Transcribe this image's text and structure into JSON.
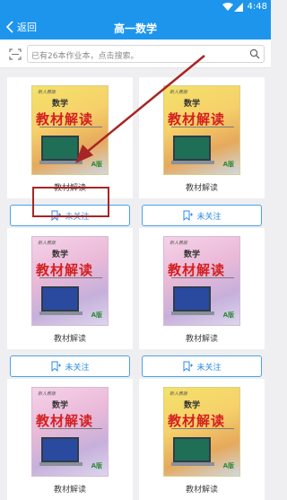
{
  "status": {
    "time": "4:48"
  },
  "nav": {
    "back_label": "返回",
    "title": "高一数学"
  },
  "search": {
    "placeholder": "已有26本作业本，点击搜索。"
  },
  "books": [
    {
      "name": "教材解读",
      "follow": "未关注",
      "cover_subject": "数学",
      "cover_title": "教材解读",
      "cover_publisher": "新人教版",
      "badge": "A版"
    },
    {
      "name": "教材解读",
      "follow": "未关注",
      "cover_subject": "数学",
      "cover_title": "教材解读",
      "cover_publisher": "新人教版",
      "badge": "A版"
    },
    {
      "name": "教材解读",
      "follow": "未关注",
      "cover_subject": "数学",
      "cover_title": "教材解读",
      "cover_publisher": "新人教版",
      "badge": "A版"
    },
    {
      "name": "教材解读",
      "follow": "未关注",
      "cover_subject": "数学",
      "cover_title": "教材解读",
      "cover_publisher": "新人教版",
      "badge": "A版"
    },
    {
      "name": "教材解读",
      "follow": "",
      "cover_subject": "数学",
      "cover_title": "教材解读",
      "cover_publisher": "新人教版",
      "badge": "A版"
    },
    {
      "name": "教材解读",
      "follow": "",
      "cover_subject": "数学",
      "cover_title": "教材解读",
      "cover_publisher": "新人教版",
      "badge": "A版"
    }
  ],
  "colors": {
    "accent": "#1d95ec",
    "annotation": "#a82525"
  }
}
